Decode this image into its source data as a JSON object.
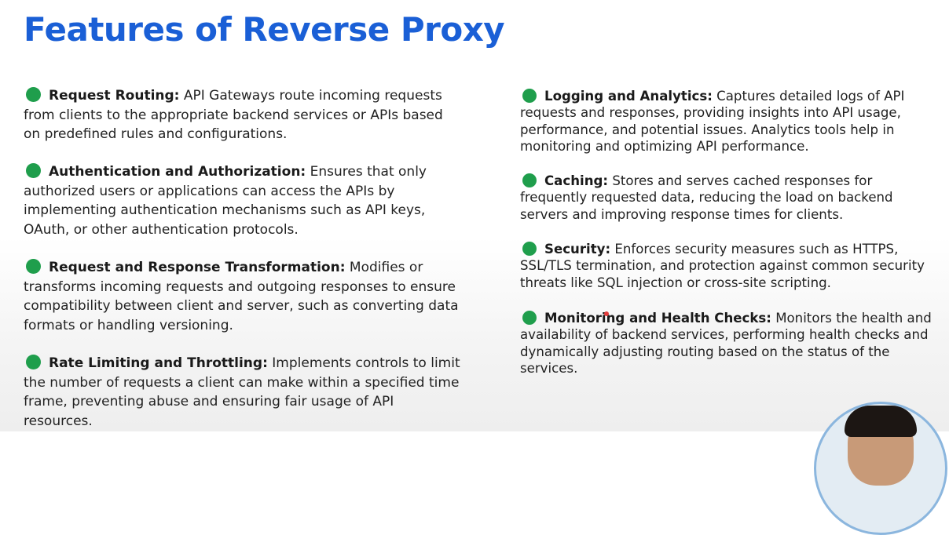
{
  "title": "Features of Reverse Proxy",
  "left_features": [
    {
      "title": "Request Routing:",
      "text": " API Gateways route incoming requests from clients to the appropriate backend services or APIs based on predefined rules and configurations."
    },
    {
      "title": "Authentication and Authorization:",
      "text": " Ensures that only authorized users or applications can access the APIs by implementing authentication mechanisms such as API keys, OAuth, or other authentication protocols."
    },
    {
      "title": "Request and Response Transformation:",
      "text": " Modifies or transforms incoming requests and outgoing responses to ensure compatibility between client and server, such as converting data formats or handling versioning."
    },
    {
      "title": "Rate Limiting and Throttling:",
      "text": " Implements controls to limit the number of requests a client can make within a specified time frame, preventing abuse and ensuring fair usage of API resources."
    }
  ],
  "right_features": [
    {
      "title": "Logging and Analytics:",
      "text": " Captures detailed logs of API requests and responses, providing insights into API usage, performance, and potential issues. Analytics tools help in monitoring and optimizing API performance."
    },
    {
      "title": "Caching:",
      "text": " Stores and serves cached responses for frequently requested data, reducing the load on backend servers and improving response times for clients."
    },
    {
      "title": "Security:",
      "text": " Enforces security measures such as HTTPS, SSL/TLS termination, and protection against common security threats like SQL injection or cross-site scripting."
    },
    {
      "title": "Monitoring and Health Checks:",
      "text": " Monitors the health and availability of backend services, performing health checks and dynamically adjusting routing based on the status of the services."
    }
  ],
  "colors": {
    "title": "#1a5fd6",
    "bullet": "#1f9e4c",
    "cursor": "#e33b3b"
  }
}
